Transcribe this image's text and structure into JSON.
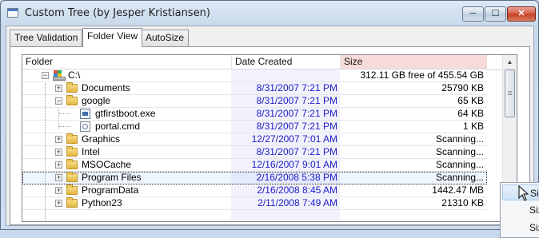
{
  "window": {
    "title": "Custom Tree (by Jesper Kristiansen)"
  },
  "caption_buttons": {
    "minimize": "─",
    "maximize": "☐",
    "close": "✕"
  },
  "tabs": [
    {
      "label": "Tree Validation",
      "active": false
    },
    {
      "label": "Folder View",
      "active": true
    },
    {
      "label": "AutoSize",
      "active": false
    }
  ],
  "columns": {
    "folder": "Folder",
    "date": "Date Created",
    "size": "Size"
  },
  "rows": [
    {
      "name": "C:\\",
      "date": "",
      "size": "312.11 GB free of 455.54 GB",
      "icon": "drive-icon",
      "expander": "minus"
    },
    {
      "name": "Documents",
      "date": "8/31/2007 7:21 PM",
      "size": "25790 KB",
      "icon": "folder-icon",
      "expander": "plus"
    },
    {
      "name": "google",
      "date": "8/31/2007 7:21 PM",
      "size": "65 KB",
      "icon": "folder-icon",
      "expander": "minus"
    },
    {
      "name": "gtfirstboot.exe",
      "date": "8/31/2007 7:21 PM",
      "size": "64 KB",
      "icon": "exe-file-icon",
      "expander": ""
    },
    {
      "name": "portal.cmd",
      "date": "8/31/2007 7:21 PM",
      "size": "1 KB",
      "icon": "cmd-file-icon",
      "expander": ""
    },
    {
      "name": "Graphics",
      "date": "12/27/2007 7:01 AM",
      "size": "Scanning...",
      "icon": "folder-icon",
      "expander": "plus"
    },
    {
      "name": "Intel",
      "date": "8/31/2007 7:21 PM",
      "size": "Scanning...",
      "icon": "folder-icon",
      "expander": "plus"
    },
    {
      "name": "MSOCache",
      "date": "12/16/2007 9:01 AM",
      "size": "Scanning...",
      "icon": "folder-icon",
      "expander": "plus"
    },
    {
      "name": "Program Files",
      "date": "2/16/2008 5:38 PM",
      "size": "Scanning...",
      "icon": "folder-icon",
      "expander": "plus",
      "selected": true
    },
    {
      "name": "ProgramData",
      "date": "2/16/2008 8:45 AM",
      "size": "1442.47 MB",
      "icon": "folder-icon",
      "expander": "plus"
    },
    {
      "name": "Python23",
      "date": "2/11/2008 7:49 AM",
      "size": "21310 KB",
      "icon": "folder-icon",
      "expander": "plus"
    }
  ],
  "context_menu": {
    "items": [
      "Size",
      "Size",
      "Size"
    ]
  },
  "colors": {
    "date_text": "#1c1cc8",
    "size_header_bg": "#f7dada",
    "date_column_bg": "#f2f2fd"
  }
}
